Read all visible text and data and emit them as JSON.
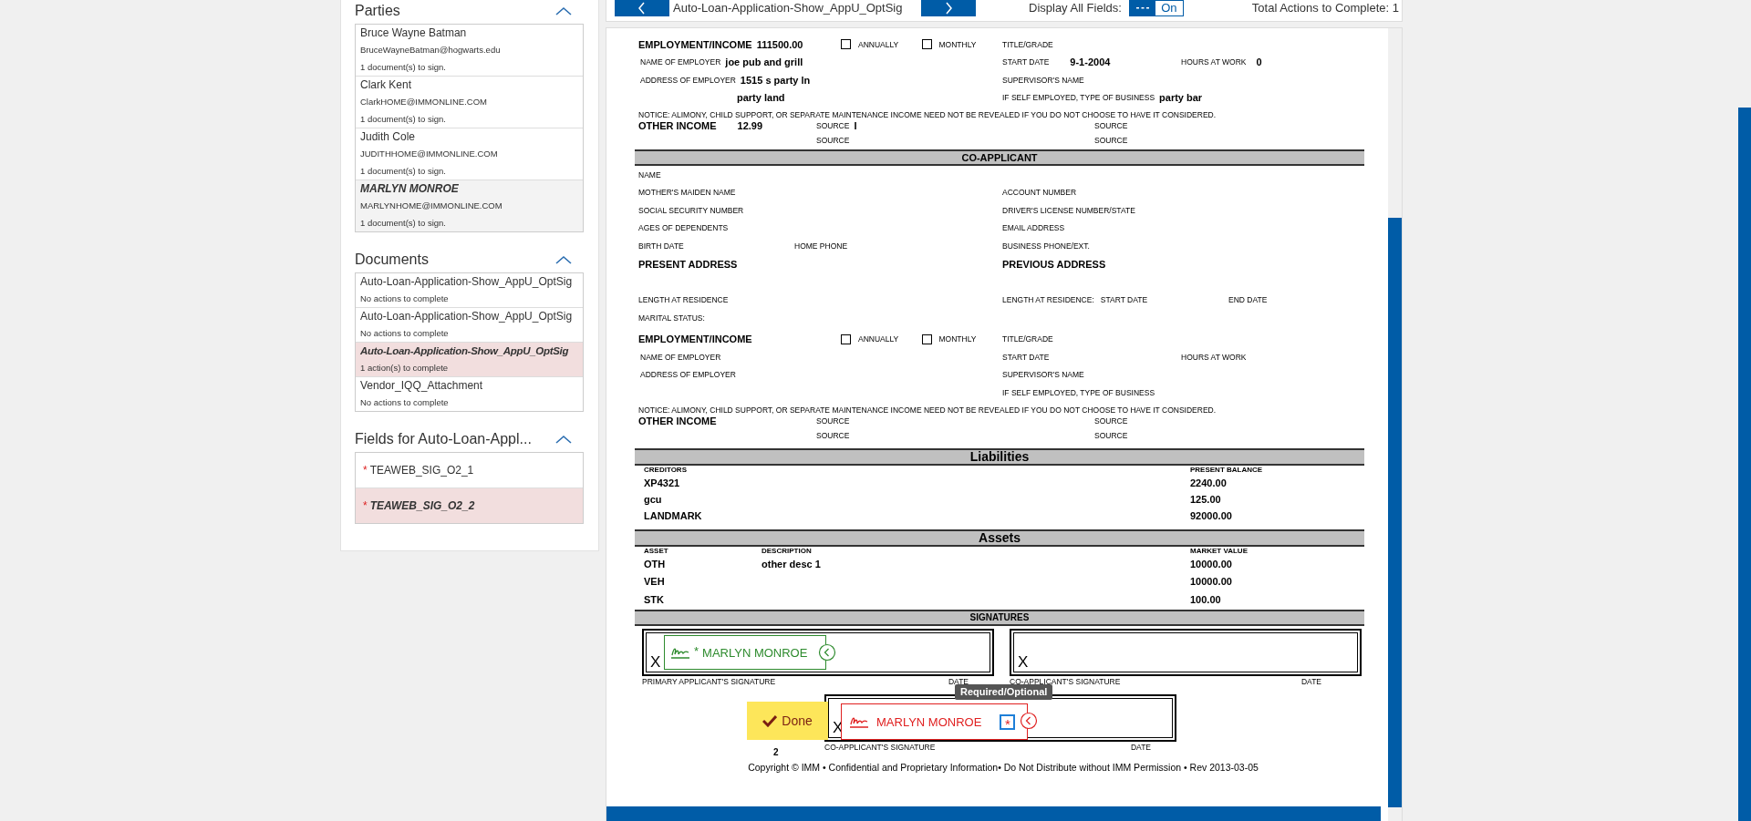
{
  "panel": {
    "sections": [
      {
        "kind": "parties",
        "title": "Parties",
        "expanded": true,
        "items": [
          {
            "name": "Bruce Wayne Batman",
            "email": "BruceWayneBatman@hogwarts.edu",
            "status": "1 document(s) to sign.",
            "selected": false
          },
          {
            "name": "Clark Kent",
            "email": "ClarkHOME@IMMONLINE.COM",
            "status": "1 document(s) to sign.",
            "selected": false
          },
          {
            "name": "Judith Cole",
            "email": "JUDITHHOME@IMMONLINE.COM",
            "status": "1 document(s) to sign.",
            "selected": false
          },
          {
            "name": "MARLYN MONROE",
            "email": "MARLYNHOME@IMMONLINE.COM",
            "status": "1 document(s) to sign.",
            "selected": true
          }
        ]
      },
      {
        "kind": "documents",
        "title": "Documents",
        "expanded": true,
        "items": [
          {
            "name": "Auto-Loan-Application-Show_AppU_OptSig",
            "status": "No actions to complete",
            "selected": false
          },
          {
            "name": "Auto-Loan-Application-Show_AppU_OptSig",
            "status": "No actions to complete",
            "selected": false
          },
          {
            "name": "Auto-Loan-Application-Show_AppU_OptSig",
            "status": "1 action(s) to complete",
            "selected": true
          },
          {
            "name": "Vendor_IQQ_Attachment",
            "status": "No actions to complete",
            "selected": false
          }
        ]
      },
      {
        "kind": "fields",
        "title": "Fields for Auto-Loan-Appl...",
        "expanded": true,
        "items": [
          {
            "mark": "*",
            "name": "TEAWEB_SIG_O2_1",
            "selected": false
          },
          {
            "mark": "*",
            "name": "TEAWEB_SIG_O2_2",
            "selected": true
          }
        ]
      }
    ]
  },
  "toolbar": {
    "document_title": "Auto-Loan-Application-Show_AppU_OptSig",
    "display_all_fields": {
      "label": "Display All Fields:",
      "on": true,
      "state_label": "On"
    },
    "total_actions": "Total Actions to Complete: 1"
  },
  "document": {
    "applicant": {
      "employment": {
        "heading": "EMPLOYMENT/INCOME",
        "value": "111500.00",
        "frequency": [
          {
            "label": "ANNUALLY",
            "checked": false
          },
          {
            "label": "MONTHLY",
            "checked": false
          }
        ],
        "title_grade": {
          "label": "TITLE/GRADE"
        },
        "employer": {
          "label": "NAME OF EMPLOYER",
          "value": "joe pub and grill"
        },
        "start_date": {
          "label": "START DATE",
          "value": "9-1-2004"
        },
        "hours": {
          "label": "HOURS AT WORK",
          "value": "0"
        },
        "address": {
          "label": "ADDRESS OF EMPLOYER",
          "lines": [
            "1515 s party ln",
            "party land"
          ]
        },
        "supervisor": {
          "label": "SUPERVISOR'S NAME"
        },
        "self_employed": {
          "label": "IF SELF EMPLOYED, TYPE OF BUSINESS",
          "value": "party bar"
        }
      },
      "notice": "NOTICE: ALIMONY, CHILD SUPPORT, OR SEPARATE MAINTENANCE INCOME NEED NOT BE REVEALED IF YOU DO NOT CHOOSE TO HAVE IT CONSIDERED.",
      "other_income": {
        "heading": "OTHER INCOME",
        "value": "12.99",
        "sources": [
          {
            "label": "SOURCE",
            "value": "I"
          },
          {
            "label": "SOURCE"
          },
          {
            "label": "SOURCE"
          },
          {
            "label": "SOURCE"
          }
        ]
      }
    },
    "co_applicant": {
      "title": "CO-APPLICANT",
      "details": [
        {
          "kind": "label",
          "left": [
            "NAME"
          ]
        },
        {
          "kind": "label",
          "left": [
            "MOTHER'S MAIDEN NAME"
          ],
          "right": [
            "ACCOUNT NUMBER"
          ]
        },
        {
          "kind": "label",
          "left": [
            "SOCIAL SECURITY NUMBER"
          ],
          "right": [
            "DRIVER'S LICENSE NUMBER/STATE"
          ]
        },
        {
          "kind": "label",
          "left": [
            "AGES OF DEPENDENTS"
          ],
          "right": [
            "EMAIL ADDRESS"
          ]
        },
        {
          "kind": "label",
          "left": [
            "BIRTH DATE"
          ],
          "middle": [
            "HOME PHONE"
          ],
          "right": [
            "BUSINESS PHONE/EXT."
          ]
        },
        {
          "kind": "heading",
          "left": [
            "PRESENT ADDRESS"
          ],
          "right": [
            "PREVIOUS ADDRESS"
          ]
        },
        {
          "kind": "label",
          "left": [
            "LENGTH AT RESIDENCE"
          ],
          "right": [
            "LENGTH AT RESIDENCE:",
            "START DATE"
          ],
          "far": [
            "END DATE"
          ]
        },
        {
          "kind": "label",
          "left": [
            "MARITAL STATUS:"
          ]
        }
      ],
      "employment": {
        "heading": "EMPLOYMENT/INCOME",
        "frequency": [
          {
            "label": "ANNUALLY",
            "checked": false
          },
          {
            "label": "MONTHLY",
            "checked": false
          }
        ],
        "title_grade": {
          "label": "TITLE/GRADE"
        },
        "employer": {
          "label": "NAME OF EMPLOYER"
        },
        "start_date": {
          "label": "START DATE"
        },
        "hours": {
          "label": "HOURS AT WORK"
        },
        "address": {
          "label": "ADDRESS OF EMPLOYER"
        },
        "supervisor": {
          "label": "SUPERVISOR'S NAME"
        },
        "self_employed": {
          "label": "IF SELF EMPLOYED, TYPE OF BUSINESS"
        }
      },
      "notice": "NOTICE: ALIMONY, CHILD SUPPORT, OR SEPARATE MAINTENANCE INCOME NEED NOT BE REVEALED IF YOU DO NOT CHOOSE TO HAVE IT CONSIDERED.",
      "other_income": {
        "heading": "OTHER INCOME",
        "sources": [
          {
            "label": "SOURCE"
          },
          {
            "label": "SOURCE"
          },
          {
            "label": "SOURCE"
          },
          {
            "label": "SOURCE"
          }
        ]
      }
    },
    "tables": [
      {
        "title": "Liabilities",
        "columns": [
          "CREDITORS",
          "PRESENT BALANCE"
        ],
        "rows": [
          [
            "XP4321",
            "2240.00"
          ],
          [
            "gcu",
            "125.00"
          ],
          [
            "LANDMARK",
            "92000.00"
          ]
        ]
      },
      {
        "title": "Assets",
        "columns": [
          "ASSET",
          "DESCRIPTION",
          "MARKET VALUE"
        ],
        "rows": [
          [
            "OTH",
            "other desc 1",
            "10000.00"
          ],
          [
            "VEH",
            null,
            "10000.00"
          ],
          [
            "STK",
            null,
            "100.00"
          ]
        ]
      }
    ],
    "signatures": {
      "title": "SIGNATURES",
      "rows": [
        [
          {
            "mark": "X",
            "label": "PRIMARY APPLICANT'S SIGNATURE",
            "date_label": "DATE",
            "field": {
              "kind": "signed",
              "required_mark": "*",
              "name": "MARLYN MONROE"
            }
          },
          {
            "mark": "X",
            "label": "CO-APPLICANT'S SIGNATURE",
            "date_label": "DATE"
          }
        ],
        [
          {
            "mark": "X",
            "label": "CO-APPLICANT'S SIGNATURE",
            "date_label": "DATE",
            "field": {
              "kind": "pending",
              "required_mark": "*",
              "name": "MARLYN MONROE",
              "tooltip": "Required/Optional"
            },
            "done": {
              "label": "Done",
              "step": "2"
            }
          }
        ]
      ]
    },
    "copyright": "Copyright © IMM • Confidential and Proprietary Information• Do Not Distribute without IMM Permission • Rev 2013-03-05"
  }
}
